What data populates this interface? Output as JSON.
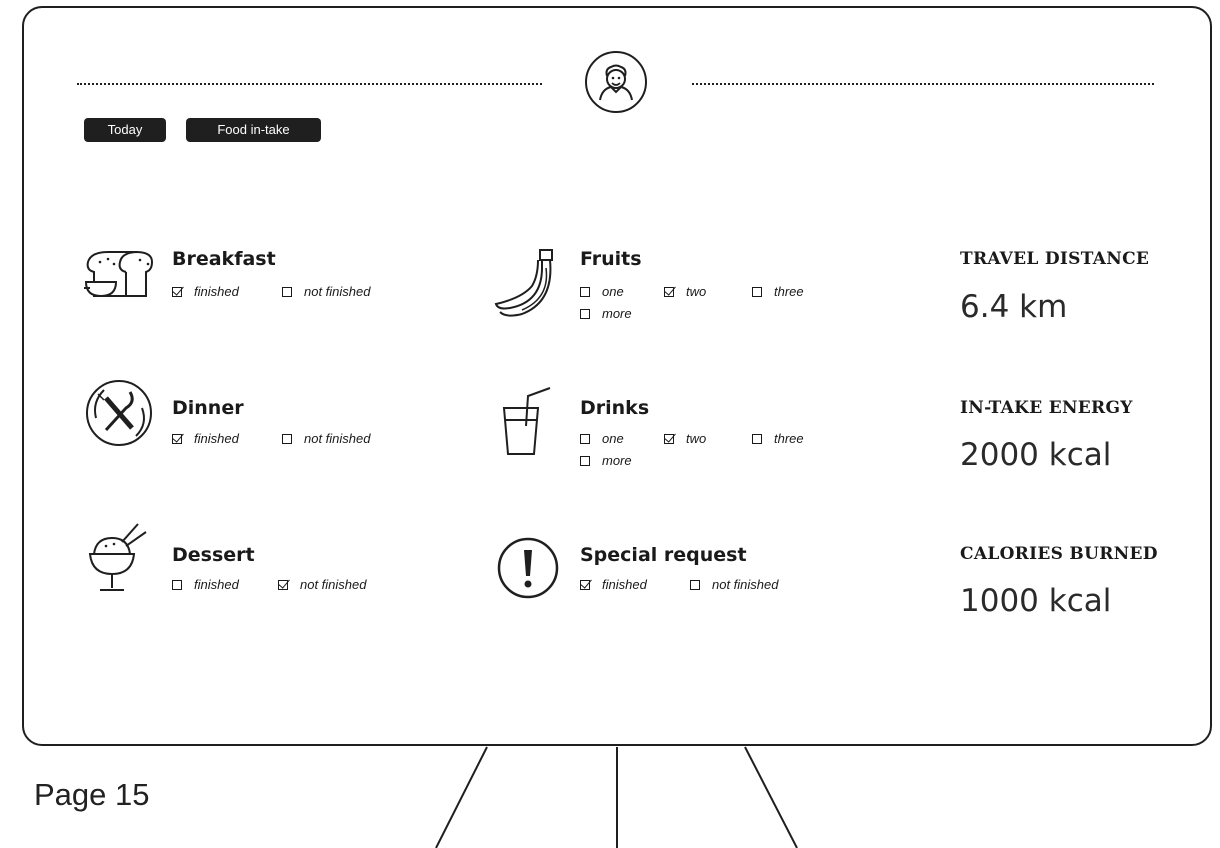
{
  "tags": {
    "today": "Today",
    "food": "Food in-take"
  },
  "items": {
    "breakfast": {
      "title": "Breakfast",
      "icon": "bread-icon",
      "options": [
        {
          "label": "finished",
          "checked": true
        },
        {
          "label": "not finished",
          "checked": false
        }
      ]
    },
    "dinner": {
      "title": "Dinner",
      "icon": "plate-cutlery-icon",
      "options": [
        {
          "label": "finished",
          "checked": true
        },
        {
          "label": "not finished",
          "checked": false
        }
      ]
    },
    "dessert": {
      "title": "Dessert",
      "icon": "dessert-bowl-icon",
      "options": [
        {
          "label": "finished",
          "checked": false
        },
        {
          "label": "not finished",
          "checked": true
        }
      ]
    },
    "fruits": {
      "title": "Fruits",
      "icon": "banana-icon",
      "options": [
        {
          "label": "one",
          "checked": false
        },
        {
          "label": "two",
          "checked": true
        },
        {
          "label": "three",
          "checked": false
        },
        {
          "label": "more",
          "checked": false
        }
      ]
    },
    "drinks": {
      "title": "Drinks",
      "icon": "drink-cup-icon",
      "options": [
        {
          "label": "one",
          "checked": false
        },
        {
          "label": "two",
          "checked": true
        },
        {
          "label": "three",
          "checked": false
        },
        {
          "label": "more",
          "checked": false
        }
      ]
    },
    "special": {
      "title": "Special request",
      "icon": "exclamation-icon",
      "options": [
        {
          "label": "finished",
          "checked": true
        },
        {
          "label": "not finished",
          "checked": false
        }
      ]
    }
  },
  "stats": {
    "distance": {
      "label": "TRAVEL DISTANCE",
      "value": "6.4 km"
    },
    "energy": {
      "label": "IN-TAKE ENERGY",
      "value": "2000 kcal"
    },
    "burned": {
      "label": "CALORIES BURNED",
      "value": "1000 kcal"
    }
  },
  "page": {
    "label": "Page 15"
  }
}
